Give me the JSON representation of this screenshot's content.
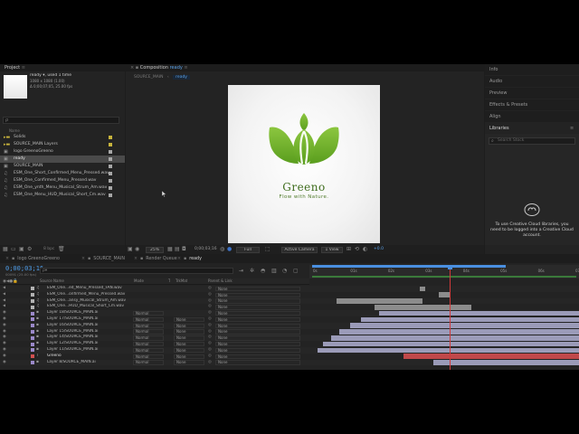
{
  "project_panel": {
    "tab_label": "Project",
    "item_name": "ready ▾",
    "item_used": ", used 1 time",
    "item_dims": "1080 x 1080 (1.00)",
    "item_duration": "Δ 0;00;07;05, 25.00 fps",
    "search_placeholder": "ρ",
    "col_name": "Name",
    "items": [
      {
        "name": "Solids",
        "type": "folder",
        "color": "#c8b43c"
      },
      {
        "name": "SOURCE_MAIN Layers",
        "type": "folder",
        "color": "#c8b43c"
      },
      {
        "name": "logo GreenoGreeno",
        "type": "comp",
        "color": "#a7a7a7"
      },
      {
        "name": "ready",
        "type": "comp",
        "color": "#a7a7a7",
        "selected": true
      },
      {
        "name": "SOURCE_MAIN",
        "type": "comp",
        "color": "#a7a7a7"
      },
      {
        "name": "ESM_One_Short_Confirmed_Menu_Pressed.wav",
        "type": "audio",
        "color": "#a7a7a7"
      },
      {
        "name": "ESM_One_Confirmed_Menu_Pressed.wav",
        "type": "audio",
        "color": "#a7a7a7"
      },
      {
        "name": "ESM_One_ynth_Menu_Musical_Strum_Am.wav",
        "type": "audio",
        "color": "#a7a7a7"
      },
      {
        "name": "ESM_One_Menu_HUD_Musical_Short_Cm.wav",
        "type": "audio",
        "color": "#a7a7a7"
      }
    ],
    "bpc": "8 bpc"
  },
  "comp_panel": {
    "tab_label": "Composition ready",
    "tab_prefix": "Composition",
    "tab_name": "ready",
    "breadcrumb_parent": "SOURCE_MAIN",
    "breadcrumb_current": "ready",
    "zoom": "25%",
    "timecode": "0;00;03;16",
    "resolution": "Full",
    "camera": "Active Camera",
    "views": "1 View",
    "exposure": "+0.0"
  },
  "logo": {
    "brand_name": "Greeno",
    "tagline": "Flow with Nature.",
    "color_dark": "#5a9e1e",
    "color_light": "#8cc63f"
  },
  "right_panels": {
    "items": [
      "Info",
      "Audio",
      "Preview",
      "Effects & Presets",
      "Align",
      "Libraries"
    ],
    "search_placeholder": "Search Stock",
    "message": "To use Creative Cloud libraries, you need to be logged into a Creative Cloud account."
  },
  "timeline": {
    "tabs": [
      {
        "label": "logo GreenoGreeno",
        "active": false
      },
      {
        "label": "SOURCE_MAIN",
        "active": false
      },
      {
        "label": "Render Queue",
        "active": false
      },
      {
        "label": "ready",
        "active": true
      }
    ],
    "timecode": "0;00;03;16",
    "timecode_sub": "00091 (25.00 fps)",
    "search_placeholder": "ρ▾",
    "col_source": "Source Name",
    "col_mode": "Mode",
    "col_t": "T",
    "col_trkmat": "TrkMat",
    "col_parent": "Parent & Link",
    "ruler_labels": [
      "0s",
      "01s",
      "02s",
      "03s",
      "04s",
      "05s",
      "06s",
      "07s"
    ],
    "playhead_fraction": 0.52,
    "layers": [
      {
        "name": "ESM_One...ed_Menu_Pressed_FAN.wav",
        "type": "audio",
        "label_color": "#b2b2b2",
        "mode": "",
        "trkmat": "",
        "parent": "None",
        "bar_start": 0.41,
        "bar_end": 0.43,
        "bar_color": "#8c8c8c"
      },
      {
        "name": "ESM_One...onfirmed_Menu_Pressed.wav",
        "type": "audio",
        "label_color": "#b2b2b2",
        "mode": "",
        "trkmat": "",
        "parent": "None",
        "bar_start": 0.48,
        "bar_end": 0.52,
        "bar_color": "#8c8c8c"
      },
      {
        "name": "ESM_One...ansy_Musical_Strum_Am.wav",
        "type": "audio",
        "label_color": "#b2b2b2",
        "mode": "",
        "trkmat": "",
        "parent": "None",
        "bar_start": 0.1,
        "bar_end": 0.42,
        "bar_color": "#8c8c8c"
      },
      {
        "name": "ESM_One...HUD_Musical_Short_Cm.wav",
        "type": "audio",
        "label_color": "#b2b2b2",
        "mode": "",
        "trkmat": "",
        "parent": "None",
        "bar_start": 0.24,
        "bar_end": 0.6,
        "bar_color": "#8c8c8c"
      },
      {
        "name": "Layer 18/SOURCE_MAIN.ai",
        "type": "ai",
        "label_color": "#9b89c9",
        "mode": "Normal",
        "trkmat": "",
        "parent": "None",
        "bar_start": 0.26,
        "bar_end": 1.0,
        "bar_color": "#9b9bb8"
      },
      {
        "name": "Layer 17/SOURCE_MAIN.ai",
        "type": "ai",
        "label_color": "#9b89c9",
        "mode": "Normal",
        "trkmat": "None",
        "parent": "None",
        "bar_start": 0.19,
        "bar_end": 1.0,
        "bar_color": "#9b9bb8"
      },
      {
        "name": "Layer 16/SOURCE_MAIN.ai",
        "type": "ai",
        "label_color": "#9b89c9",
        "mode": "Normal",
        "trkmat": "None",
        "parent": "None",
        "bar_start": 0.15,
        "bar_end": 1.0,
        "bar_color": "#9b9bb8"
      },
      {
        "name": "Layer 15/SOURCE_MAIN.ai",
        "type": "ai",
        "label_color": "#9b89c9",
        "mode": "Normal",
        "trkmat": "None",
        "parent": "None",
        "bar_start": 0.11,
        "bar_end": 1.0,
        "bar_color": "#9b9bb8"
      },
      {
        "name": "Layer 14/SOURCE_MAIN.ai",
        "type": "ai",
        "label_color": "#9b89c9",
        "mode": "Normal",
        "trkmat": "None",
        "parent": "None",
        "bar_start": 0.08,
        "bar_end": 1.0,
        "bar_color": "#9b9bb8"
      },
      {
        "name": "Layer 12/SOURCE_MAIN.ai",
        "type": "ai",
        "label_color": "#9b89c9",
        "mode": "Normal",
        "trkmat": "None",
        "parent": "None",
        "bar_start": 0.05,
        "bar_end": 1.0,
        "bar_color": "#9b9bb8"
      },
      {
        "name": "Layer 11/SOURCE_MAIN.ai",
        "type": "ai",
        "label_color": "#9b89c9",
        "mode": "Normal",
        "trkmat": "None",
        "parent": "None",
        "bar_start": 0.03,
        "bar_end": 1.0,
        "bar_color": "#9b9bb8"
      },
      {
        "name": "Greeno",
        "type": "text",
        "label_color": "#d25050",
        "mode": "Normal",
        "trkmat": "None",
        "parent": "None",
        "bar_start": 0.35,
        "bar_end": 1.0,
        "bar_color": "#c0484a"
      },
      {
        "name": "Layer 8/SOURCE_MAIN.ai",
        "type": "ai",
        "label_color": "#9b89c9",
        "mode": "Normal",
        "trkmat": "None",
        "parent": "None",
        "bar_start": 0.46,
        "bar_end": 1.0,
        "bar_color": "#9b9bb8"
      }
    ]
  }
}
